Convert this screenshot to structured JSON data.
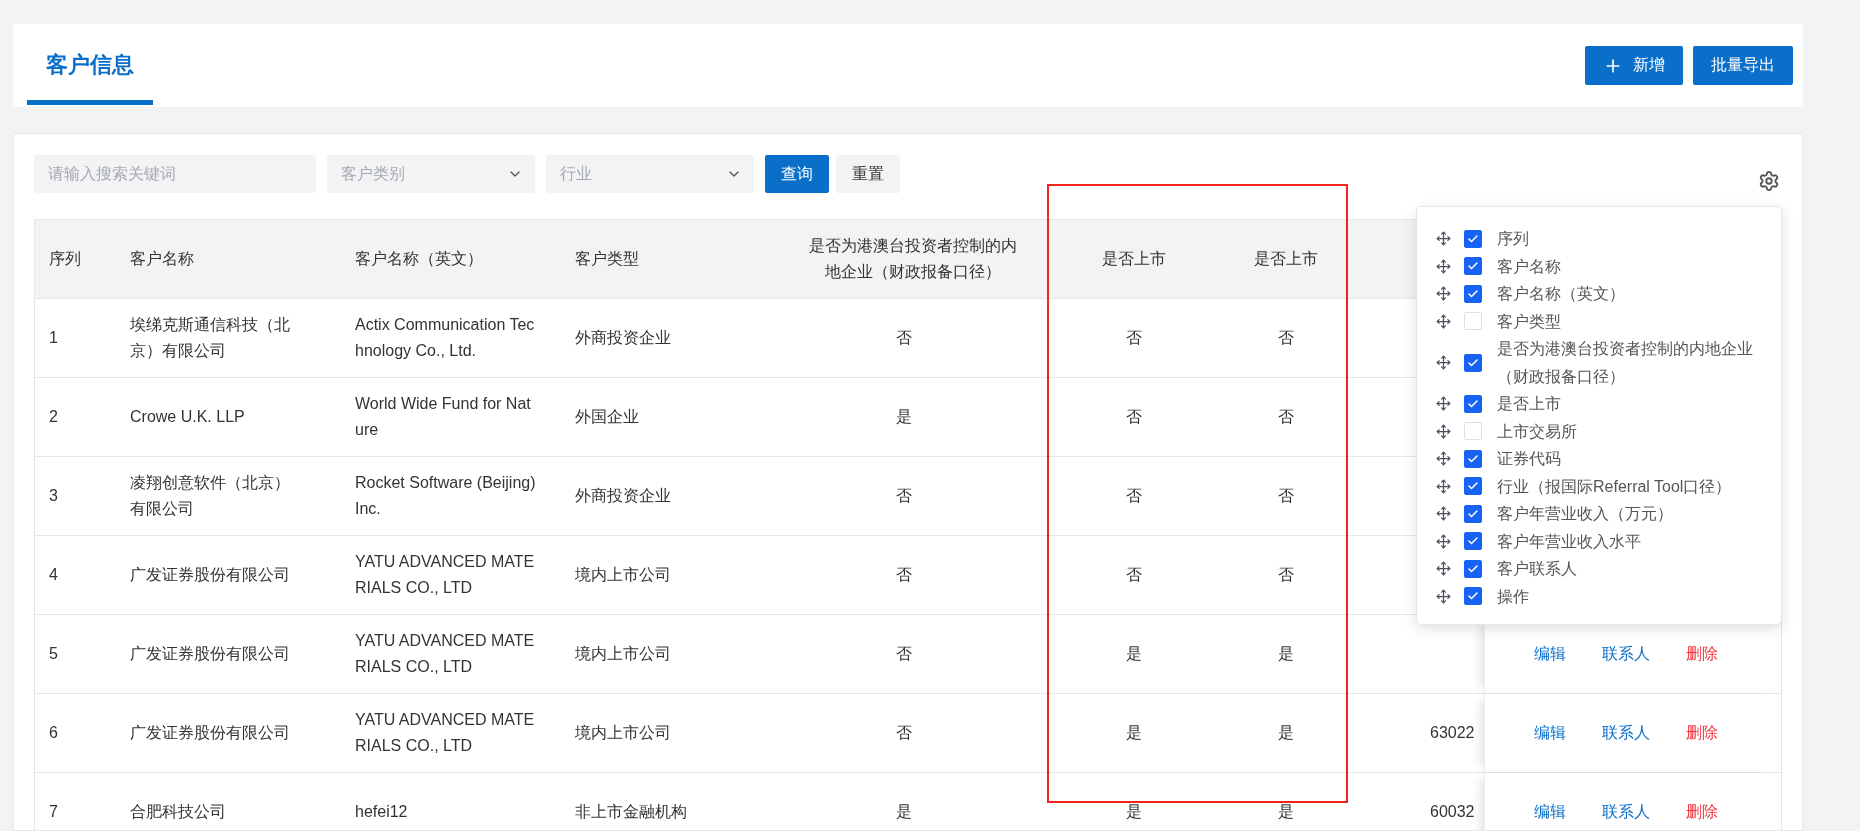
{
  "header": {
    "tabs": [
      {
        "label": "客户信息",
        "selected": true
      }
    ],
    "buttons": [
      {
        "label": "新增",
        "kind": "add"
      },
      {
        "label": "批量导出",
        "kind": "plain"
      }
    ]
  },
  "filters": {
    "search": {
      "placeholder": "请输入搜索关键词"
    },
    "selects": [
      {
        "placeholder": "客户类别"
      },
      {
        "placeholder": "行业"
      }
    ],
    "buttons": [
      {
        "label": "查询",
        "kind": "primary"
      },
      {
        "label": "重置",
        "kind": "secondary"
      }
    ]
  },
  "table": {
    "columns": [
      "序列",
      "客户名称",
      "客户名称（英文）",
      "客户类型",
      "是否为港澳台投资者控制的内地企业（财政报备口径）",
      "是否上市",
      "是否上市"
    ],
    "rows": [
      {
        "cells": [
          "1",
          "埃绨克斯通信科技（北京）有限公司",
          "Actix Communication Technology Co., Ltd.",
          "外商投资企业",
          "否",
          "否",
          "否"
        ]
      },
      {
        "cells": [
          "2",
          "Crowe U.K. LLP",
          "World Wide Fund for Nature",
          "外国企业",
          "是",
          "否",
          "否"
        ]
      },
      {
        "cells": [
          "3",
          "凌翔创意软件（北京）有限公司",
          "Rocket Software (Beijing) Inc.",
          "外商投资企业",
          "否",
          "否",
          "否"
        ]
      },
      {
        "cells": [
          "4",
          "广发证券股份有限公司",
          "YATU ADVANCED MATERIALS CO., LTD",
          "境内上市公司",
          "否",
          "否",
          "否"
        ]
      },
      {
        "cells": [
          "5",
          "广发证券股份有限公司",
          "YATU ADVANCED MATERIALS CO., LTD",
          "境内上市公司",
          "否",
          "是",
          "是"
        ],
        "actions": [
          {
            "label": "编辑",
            "kind": "link"
          },
          {
            "label": "联系人",
            "kind": "link"
          },
          {
            "label": "删除",
            "kind": "danger"
          }
        ]
      },
      {
        "cells": [
          "6",
          "广发证券股份有限公司",
          "YATU ADVANCED MATERIALS CO., LTD",
          "境内上市公司",
          "否",
          "是",
          "是"
        ],
        "code": "63022",
        "actions": [
          {
            "label": "编辑",
            "kind": "link"
          },
          {
            "label": "联系人",
            "kind": "link"
          },
          {
            "label": "删除",
            "kind": "danger"
          }
        ]
      },
      {
        "cells": [
          "7",
          "合肥科技公司",
          "hefei12",
          "非上市金融机构",
          "是",
          "是",
          "是"
        ],
        "code": "60032",
        "actions": [
          {
            "label": "编辑",
            "kind": "link"
          },
          {
            "label": "联系人",
            "kind": "link"
          },
          {
            "label": "删除",
            "kind": "danger"
          }
        ]
      }
    ]
  },
  "column_settings": {
    "items": [
      {
        "label": "序列",
        "checked": true
      },
      {
        "label": "客户名称",
        "checked": true
      },
      {
        "label": "客户名称（英文）",
        "checked": true
      },
      {
        "label": "客户类型",
        "checked": false
      },
      {
        "label": "是否为港澳台投资者控制的内地企业（财政报备口径）",
        "checked": true
      },
      {
        "label": "是否上市",
        "checked": true
      },
      {
        "label": "上市交易所",
        "checked": false
      },
      {
        "label": "证券代码",
        "checked": true
      },
      {
        "label": "行业（报国际Referral Tool口径）",
        "checked": true
      },
      {
        "label": "客户年营业收入（万元）",
        "checked": true
      },
      {
        "label": "客户年营业收入水平",
        "checked": true
      },
      {
        "label": "客户联系人",
        "checked": true
      },
      {
        "label": "操作",
        "checked": true
      }
    ]
  },
  "highlight": {
    "visible": true
  }
}
